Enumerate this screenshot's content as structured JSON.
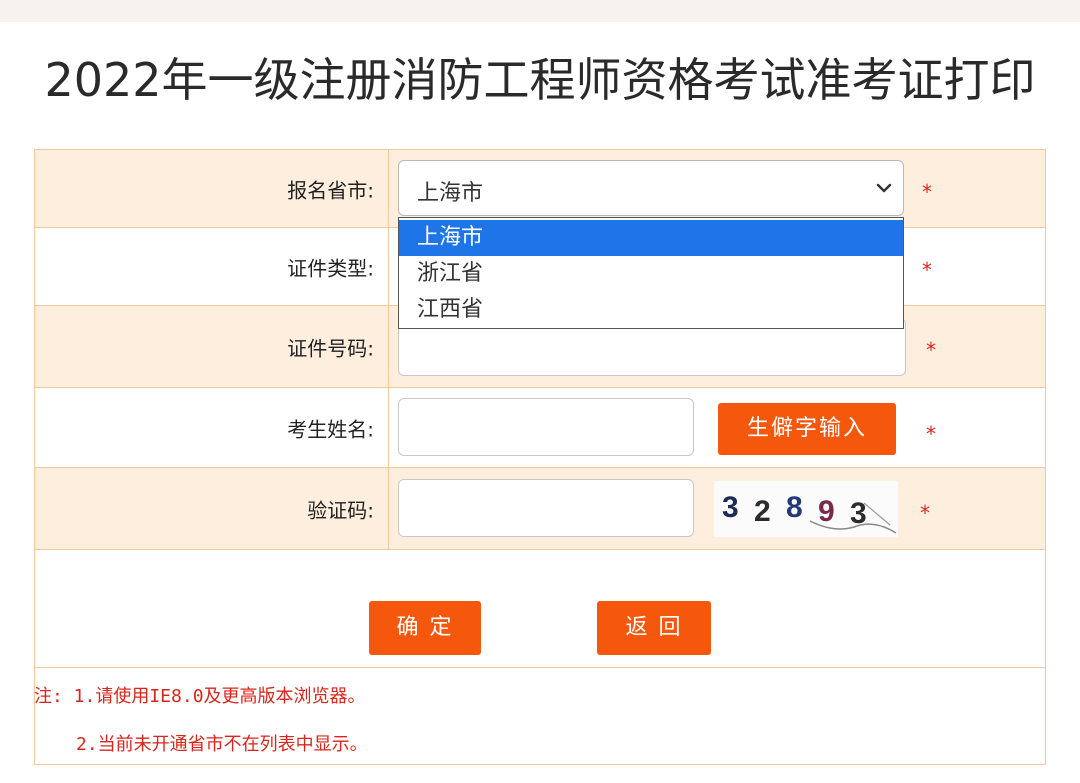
{
  "page": {
    "title": "2022年一级注册消防工程师资格考试准考证打印"
  },
  "form": {
    "province_label": "报名省市:",
    "province_value": "上海市",
    "province_options": [
      "上海市",
      "浙江省",
      "江西省"
    ],
    "id_type_label": "证件类型:",
    "id_number_label": "证件号码:",
    "name_label": "考生姓名:",
    "rare_char_button": "生僻字输入",
    "captcha_label": "验证码:",
    "captcha_text": "32893",
    "required_mark": "*"
  },
  "actions": {
    "confirm": "确 定",
    "back": "返 回"
  },
  "notes": {
    "line1": "注: 1.请使用IE8.0及更高版本浏览器。",
    "line2": "2.当前未开通省市不在列表中显示。"
  },
  "colors": {
    "accent": "#f5580c",
    "row_alt": "#fdeede",
    "border": "#f0c8a0",
    "required": "#d9261c",
    "dropdown_selected": "#1e75e8"
  }
}
